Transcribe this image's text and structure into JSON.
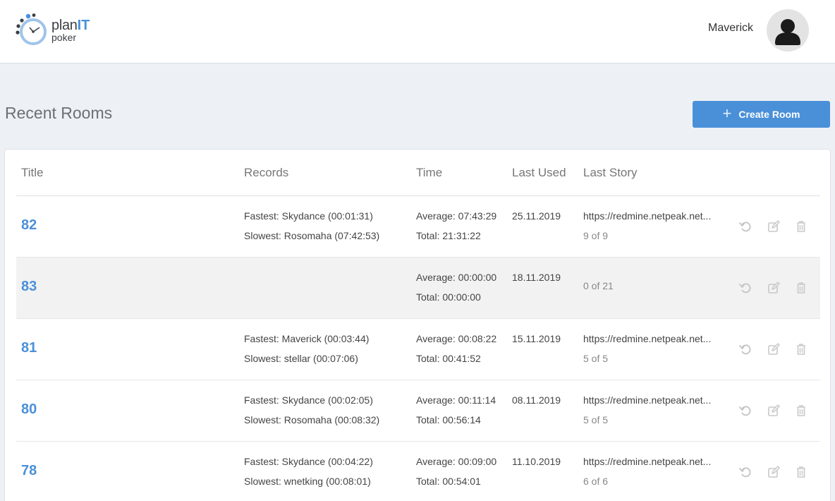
{
  "app": {
    "logo_plan": "plan",
    "logo_it": "IT",
    "logo_poker": "poker"
  },
  "user": {
    "name": "Maverick"
  },
  "page": {
    "title": "Recent Rooms",
    "create_label": "Create Room"
  },
  "table": {
    "headers": {
      "title": "Title",
      "records": "Records",
      "time": "Time",
      "last_used": "Last Used",
      "last_story": "Last Story"
    },
    "rows": [
      {
        "title": "82",
        "fastest": "Fastest: Skydance (00:01:31)",
        "slowest": "Slowest: Rosomaha (07:42:53)",
        "average": "Average: 07:43:29",
        "total": "Total: 21:31:22",
        "last_used": "25.11.2019",
        "story_url": "https://redmine.netpeak.net...",
        "story_count": "9 of 9"
      },
      {
        "title": "83",
        "fastest": "",
        "slowest": "",
        "average": "Average: 00:00:00",
        "total": "Total: 00:00:00",
        "last_used": "18.11.2019",
        "story_url": "",
        "story_count": "0 of 21"
      },
      {
        "title": "81",
        "fastest": "Fastest: Maverick (00:03:44)",
        "slowest": "Slowest: stellar (00:07:06)",
        "average": "Average: 00:08:22",
        "total": "Total: 00:41:52",
        "last_used": "15.11.2019",
        "story_url": "https://redmine.netpeak.net...",
        "story_count": "5 of 5"
      },
      {
        "title": "80",
        "fastest": "Fastest: Skydance (00:02:05)",
        "slowest": "Slowest: Rosomaha (00:08:32)",
        "average": "Average: 00:11:14",
        "total": "Total: 00:56:14",
        "last_used": "08.11.2019",
        "story_url": "https://redmine.netpeak.net...",
        "story_count": "5 of 5"
      },
      {
        "title": "78",
        "fastest": "Fastest: Skydance (00:04:22)",
        "slowest": "Slowest: wnetking (00:08:01)",
        "average": "Average: 00:09:00",
        "total": "Total: 00:54:01",
        "last_used": "11.10.2019",
        "story_url": "https://redmine.netpeak.net...",
        "story_count": "6 of 6"
      }
    ]
  },
  "icons": {
    "reset": "reset-icon",
    "edit": "edit-icon",
    "delete": "trash-icon",
    "plus": "plus-icon",
    "logo": "stopwatch-logo",
    "avatar": "user-avatar-icon"
  },
  "colors": {
    "accent": "#4a90d9",
    "background": "#edf1f5",
    "row_alt": "#f2f2f2",
    "icon": "#c8c8c8"
  }
}
